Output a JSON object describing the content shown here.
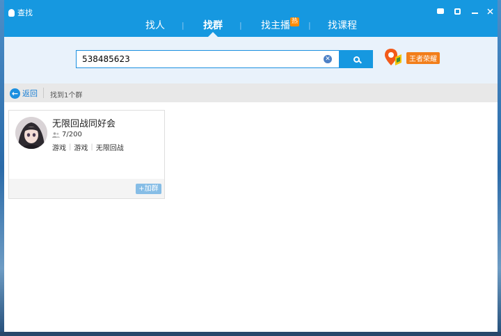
{
  "window": {
    "title": "查找",
    "tabs": [
      {
        "label": "找人",
        "active": false
      },
      {
        "label": "找群",
        "active": true
      },
      {
        "label": "找主播",
        "active": false,
        "badge": "热"
      },
      {
        "label": "找课程",
        "active": false
      }
    ],
    "tab_separator": "|"
  },
  "search": {
    "value": "538485623",
    "clear_glyph": "✕"
  },
  "promo": {
    "tag": "王者荣耀"
  },
  "nav": {
    "back_label": "返回",
    "back_glyph": "←",
    "result_text": "找到1个群"
  },
  "results": [
    {
      "name": "无限回战同好会",
      "members": "7/200",
      "tags": [
        "游戏",
        "游戏",
        "无限回战"
      ],
      "join_label": "+加群"
    }
  ],
  "colors": {
    "accent": "#1698e0",
    "search_area": "#e9f2fb",
    "promo_tag": "#f27e1a",
    "join_button": "#86bde6"
  }
}
